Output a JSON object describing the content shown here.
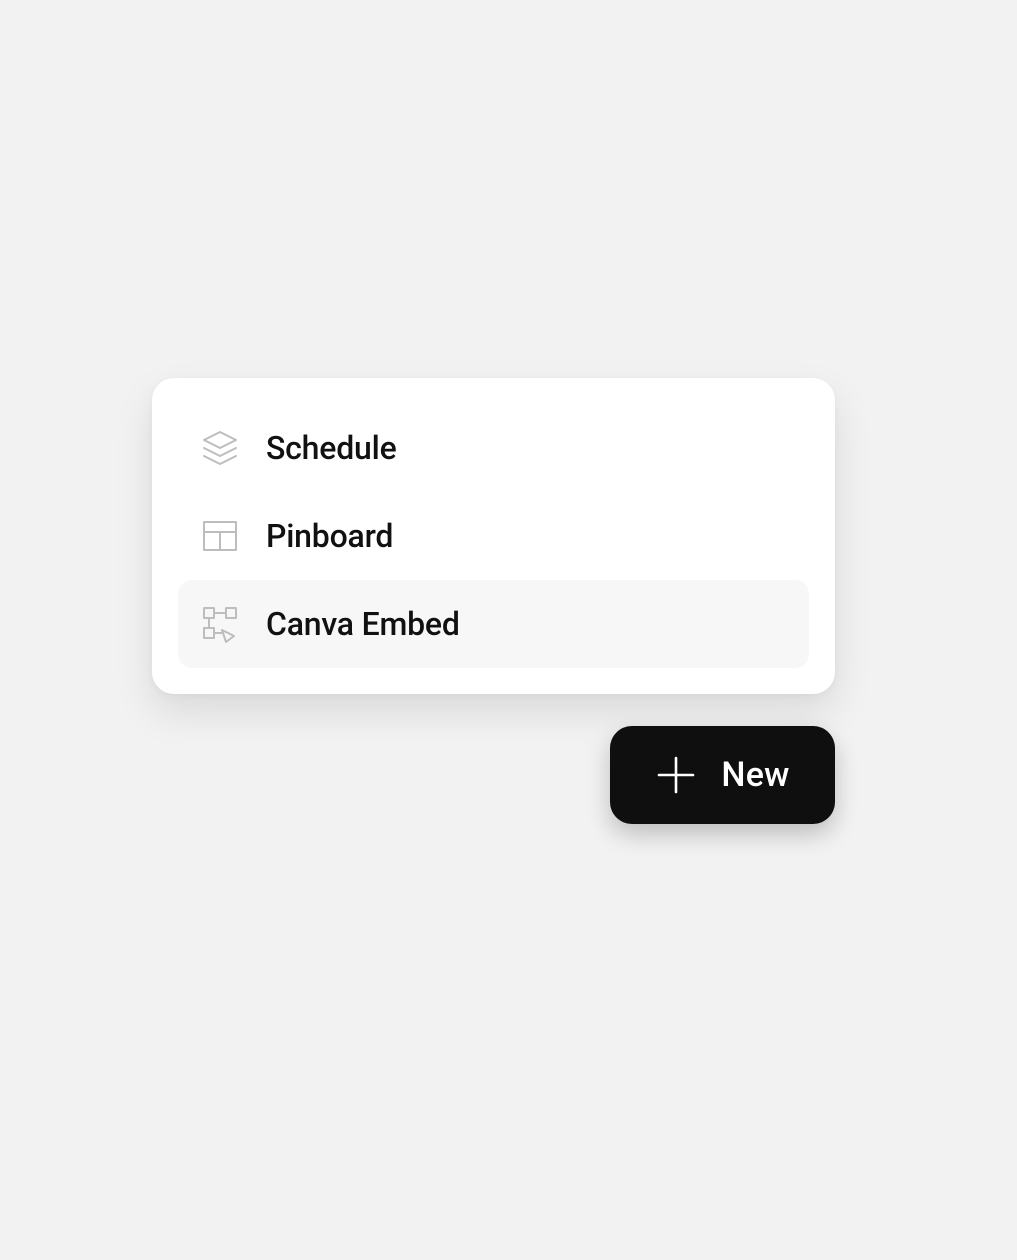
{
  "menu": {
    "items": [
      {
        "label": "Schedule",
        "icon": "layers-icon",
        "highlight": false
      },
      {
        "label": "Pinboard",
        "icon": "layout-icon",
        "highlight": false
      },
      {
        "label": "Canva Embed",
        "icon": "diagram-icon",
        "highlight": true
      }
    ]
  },
  "button": {
    "new_label": "New"
  },
  "colors": {
    "background": "#f2f2f2",
    "card": "#ffffff",
    "item_highlight": "#f7f7f7",
    "icon_stroke": "#bdbdbd",
    "text": "#111111",
    "button_bg": "#0f0f0f",
    "button_fg": "#ffffff"
  }
}
